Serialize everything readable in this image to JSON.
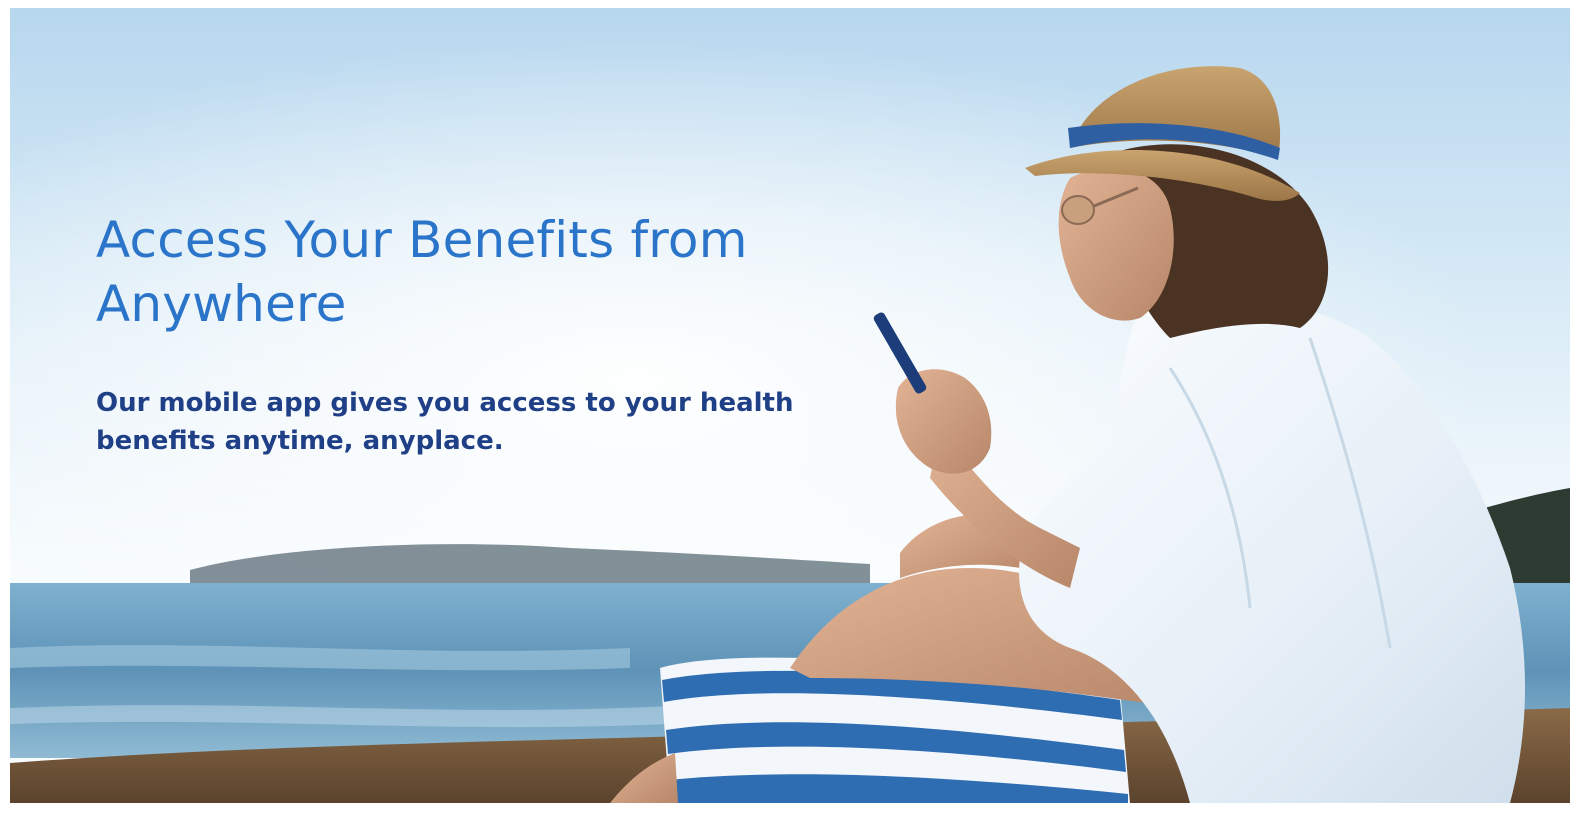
{
  "banner": {
    "headline": "Access Your Benefits from Anywhere",
    "subtext": "Our mobile app gives you access to your health benefits anytime, anyplace."
  },
  "photo": {
    "description": "",
    "accent_color": "#2a74c9",
    "text_color": "#1f3f86"
  }
}
